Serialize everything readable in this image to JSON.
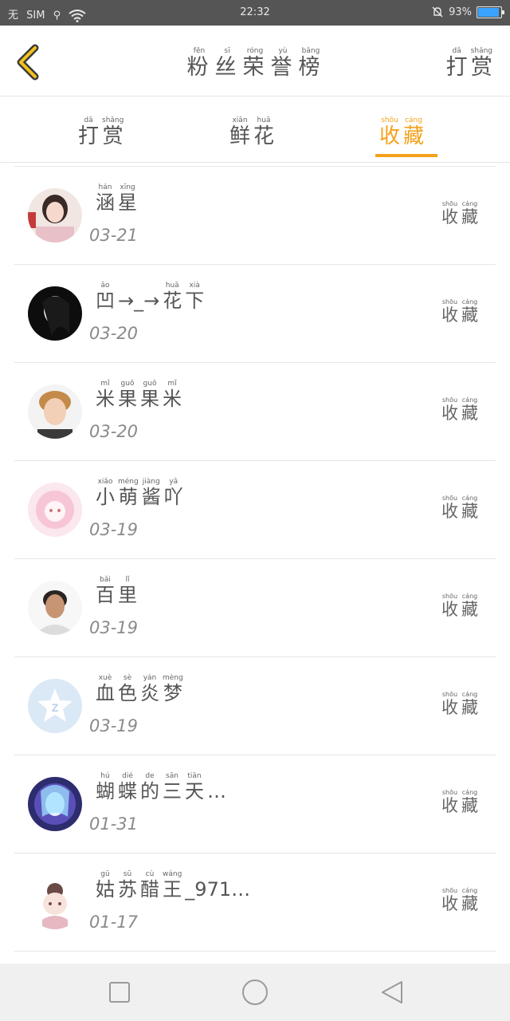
{
  "status_bar": {
    "left_items": [
      "无",
      "SIM",
      "⚲"
    ],
    "time": "22:32",
    "battery_text": "93%",
    "battery_level": 0.93
  },
  "header": {
    "title_chars": [
      {
        "py": "fěn",
        "ch": "粉"
      },
      {
        "py": "sī",
        "ch": "丝"
      },
      {
        "py": "róng",
        "ch": "荣"
      },
      {
        "py": "yù",
        "ch": "誉"
      },
      {
        "py": "bǎng",
        "ch": "榜"
      }
    ],
    "action_chars": [
      {
        "py": "dǎ",
        "ch": "打"
      },
      {
        "py": "shǎng",
        "ch": "赏"
      }
    ]
  },
  "tabs": [
    {
      "chars": [
        {
          "py": "dǎ",
          "ch": "打"
        },
        {
          "py": "shǎng",
          "ch": "赏"
        }
      ],
      "active": false
    },
    {
      "chars": [
        {
          "py": "xiān",
          "ch": "鲜"
        },
        {
          "py": "huā",
          "ch": "花"
        }
      ],
      "active": false
    },
    {
      "chars": [
        {
          "py": "shōu",
          "ch": "收"
        },
        {
          "py": "cáng",
          "ch": "藏"
        }
      ],
      "active": true
    }
  ],
  "colors": {
    "accent": "#f4a11b",
    "status_bar": "#555555",
    "divider": "#e6e6e6",
    "text": "#555555"
  },
  "row_action": [
    {
      "py": "shōu",
      "ch": "收"
    },
    {
      "py": "cáng",
      "ch": "藏"
    }
  ],
  "rows": [
    {
      "name": [
        {
          "py": "hán",
          "ch": "涵"
        },
        {
          "py": "xīng",
          "ch": "星"
        }
      ],
      "date": "03-21",
      "avatar": "avatar-girl-photo"
    },
    {
      "name": [
        {
          "py": "āo",
          "ch": "凹"
        },
        {
          "py": "",
          "ch": "→_→"
        },
        {
          "py": "huā",
          "ch": "花"
        },
        {
          "py": "xià",
          "ch": "下"
        }
      ],
      "date": "03-20",
      "avatar": "avatar-dark-photo"
    },
    {
      "name": [
        {
          "py": "mǐ",
          "ch": "米"
        },
        {
          "py": "guǒ",
          "ch": "果"
        },
        {
          "py": "guǒ",
          "ch": "果"
        },
        {
          "py": "mǐ",
          "ch": "米"
        }
      ],
      "date": "03-20",
      "avatar": "avatar-boy-photo"
    },
    {
      "name": [
        {
          "py": "xiǎo",
          "ch": "小"
        },
        {
          "py": "méng",
          "ch": "萌"
        },
        {
          "py": "jiàng",
          "ch": "酱"
        },
        {
          "py": "yā",
          "ch": "吖"
        }
      ],
      "date": "03-19",
      "avatar": "avatar-pink-anime"
    },
    {
      "name": [
        {
          "py": "bǎi",
          "ch": "百"
        },
        {
          "py": "lǐ",
          "ch": "里"
        }
      ],
      "date": "03-19",
      "avatar": "avatar-man-photo"
    },
    {
      "name": [
        {
          "py": "xuè",
          "ch": "血"
        },
        {
          "py": "sè",
          "ch": "色"
        },
        {
          "py": "yán",
          "ch": "炎"
        },
        {
          "py": "mèng",
          "ch": "梦"
        }
      ],
      "date": "03-19",
      "avatar": "avatar-default-star"
    },
    {
      "name": [
        {
          "py": "hú",
          "ch": "蝴"
        },
        {
          "py": "dié",
          "ch": "蝶"
        },
        {
          "py": "de",
          "ch": "的"
        },
        {
          "py": "sān",
          "ch": "三"
        },
        {
          "py": "tiān",
          "ch": "天"
        },
        {
          "py": "",
          "ch": "…"
        }
      ],
      "date": "01-31",
      "avatar": "avatar-blue-anime"
    },
    {
      "name": [
        {
          "py": "gū",
          "ch": "姑"
        },
        {
          "py": "sū",
          "ch": "苏"
        },
        {
          "py": "cù",
          "ch": "醋"
        },
        {
          "py": "wáng",
          "ch": "王"
        },
        {
          "py": "",
          "ch": "_971…"
        }
      ],
      "date": "01-17",
      "avatar": "avatar-chibi-anime"
    }
  ],
  "navbar": [
    "square-icon",
    "circle-icon",
    "triangle-back-icon"
  ]
}
